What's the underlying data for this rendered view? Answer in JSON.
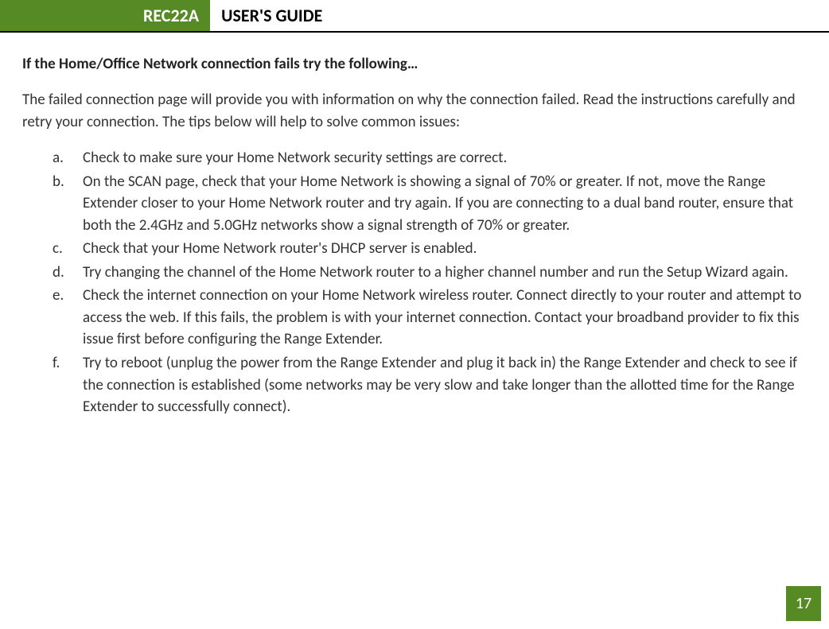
{
  "header": {
    "model": "REC22A",
    "title": "USER'S GUIDE"
  },
  "section": {
    "heading": "If the Home/Office Network connection fails try the following…",
    "intro": "The failed connection page will provide you with information on why the connection failed. Read the instructions carefully and retry your connection. The tips below will help to solve common issues:",
    "items": [
      {
        "marker": "a.",
        "text": "Check to make sure your Home Network security settings are correct."
      },
      {
        "marker": "b.",
        "text": "On the SCAN page, check that your Home Network is showing a signal of 70% or greater. If not, move the Range Extender closer to your Home Network router and try again. If you are connecting to a dual band router, ensure that both the 2.4GHz and 5.0GHz networks show a signal strength of 70% or greater."
      },
      {
        "marker": "c.",
        "text": "Check that your Home Network router's DHCP server is enabled."
      },
      {
        "marker": "d.",
        "text": "Try changing the channel of the Home Network router to a higher channel number and run the Setup Wizard again."
      },
      {
        "marker": "e.",
        "text": "Check the internet connection on your Home Network wireless router. Connect directly to your router and attempt to access the web.  If this fails, the problem is with your internet connection.  Contact your broadband provider to fix this issue first before configuring the Range Extender."
      },
      {
        "marker": "f.",
        "text": "Try to reboot (unplug the power from the Range Extender and plug it back in) the Range Extender and check to see if the connection is established (some networks may be very slow and take longer than the allotted time for the Range Extender to successfully connect)."
      }
    ]
  },
  "page_number": "17"
}
